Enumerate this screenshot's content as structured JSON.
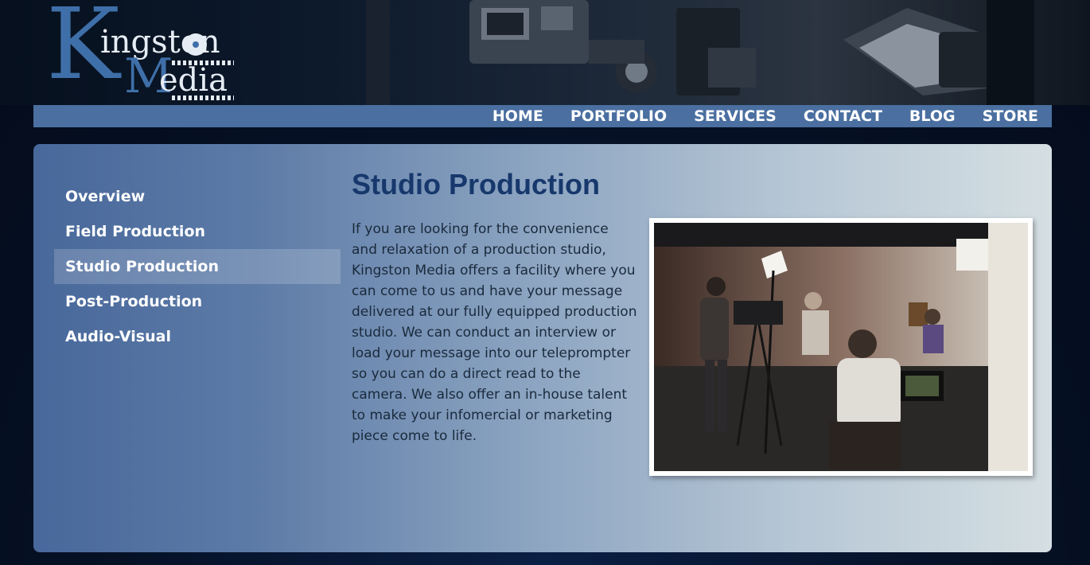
{
  "logo": {
    "initial_k": "K",
    "rest_1": "ingston",
    "initial_m": "M",
    "rest_2": "edia",
    "alt": "Kingston Media"
  },
  "nav": {
    "items": [
      {
        "label": "HOME"
      },
      {
        "label": "PORTFOLIO"
      },
      {
        "label": "SERVICES"
      },
      {
        "label": "CONTACT"
      },
      {
        "label": "BLOG"
      },
      {
        "label": "STORE"
      }
    ]
  },
  "sidebar": {
    "items": [
      {
        "label": "Overview"
      },
      {
        "label": "Field Production"
      },
      {
        "label": "Studio Production",
        "active": true
      },
      {
        "label": "Post-Production"
      },
      {
        "label": "Audio-Visual"
      }
    ]
  },
  "main": {
    "title": "Studio Production",
    "body": "If you are looking for the convenience and relaxation of a production studio, Kingston Media offers a facility where you can come to us and have your message delivered at our fully equipped production studio.  We can conduct an interview or load your message into our teleprompter so you can do a direct read to the camera. We also offer an in-house talent to make your infomercial or marketing piece come to life."
  },
  "colors": {
    "nav_bar": "#4a6fa0",
    "title": "#17386c",
    "logo_blue": "#3f6fa8"
  },
  "icons": {
    "header_banner": "film-camera-banner",
    "photo": "studio-production-photo"
  }
}
